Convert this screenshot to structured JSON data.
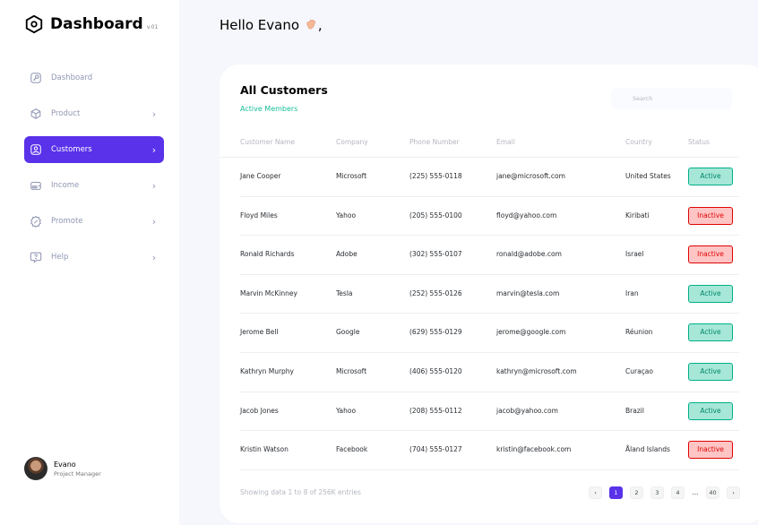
{
  "brand": {
    "title": "Dashboard",
    "version": "v.01"
  },
  "nav": [
    {
      "label": "Dashboard",
      "icon": "key-icon",
      "has_chevron": false,
      "active": false
    },
    {
      "label": "Product",
      "icon": "cube-icon",
      "has_chevron": true,
      "active": false
    },
    {
      "label": "Customers",
      "icon": "user-square-icon",
      "has_chevron": true,
      "active": true
    },
    {
      "label": "Income",
      "icon": "wallet-icon",
      "has_chevron": true,
      "active": false
    },
    {
      "label": "Promote",
      "icon": "discount-icon",
      "has_chevron": true,
      "active": false
    },
    {
      "label": "Help",
      "icon": "message-question-icon",
      "has_chevron": true,
      "active": false
    }
  ],
  "profile": {
    "name": "Evano",
    "role": "Project Manager"
  },
  "greeting": "Hello Evano",
  "greeting_suffix": ",",
  "card": {
    "title": "All Customers",
    "subtitle": "Active Members",
    "search_placeholder": "Search"
  },
  "table": {
    "headers": [
      "Customer Name",
      "Company",
      "Phone Number",
      "Email",
      "Country",
      "Status"
    ],
    "rows": [
      {
        "name": "Jane Cooper",
        "company": "Microsoft",
        "phone": "(225) 555-0118",
        "email": "jane@microsoft.com",
        "country": "United States",
        "status": "Active"
      },
      {
        "name": "Floyd Miles",
        "company": "Yahoo",
        "phone": "(205) 555-0100",
        "email": "floyd@yahoo.com",
        "country": "Kiribati",
        "status": "Inactive"
      },
      {
        "name": "Ronald Richards",
        "company": "Adobe",
        "phone": "(302) 555-0107",
        "email": "ronald@adobe.com",
        "country": "Israel",
        "status": "Inactive"
      },
      {
        "name": "Marvin McKinney",
        "company": "Tesla",
        "phone": "(252) 555-0126",
        "email": "marvin@tesla.com",
        "country": "Iran",
        "status": "Active"
      },
      {
        "name": "Jerome Bell",
        "company": "Google",
        "phone": "(629) 555-0129",
        "email": "jerome@google.com",
        "country": "Réunion",
        "status": "Active"
      },
      {
        "name": "Kathryn Murphy",
        "company": "Microsoft",
        "phone": "(406) 555-0120",
        "email": "kathryn@microsoft.com",
        "country": "Curaçao",
        "status": "Active"
      },
      {
        "name": "Jacob Jones",
        "company": "Yahoo",
        "phone": "(208) 555-0112",
        "email": "jacob@yahoo.com",
        "country": "Brazil",
        "status": "Active"
      },
      {
        "name": "Kristin Watson",
        "company": "Facebook",
        "phone": "(704) 555-0127",
        "email": "kristin@facebook.com",
        "country": "Åland Islands",
        "status": "Inactive"
      }
    ]
  },
  "footer": {
    "summary": "Showing data 1 to 8 of 256K entries"
  },
  "pagination": {
    "prev": "‹",
    "next": "›",
    "pages": [
      "1",
      "2",
      "3",
      "4"
    ],
    "ellipsis": "...",
    "last": "40",
    "current": "1"
  },
  "colors": {
    "accent": "#5932ea",
    "active_green": "#00b087",
    "inactive_red": "#df0404",
    "subtitle_green": "#16c098"
  }
}
